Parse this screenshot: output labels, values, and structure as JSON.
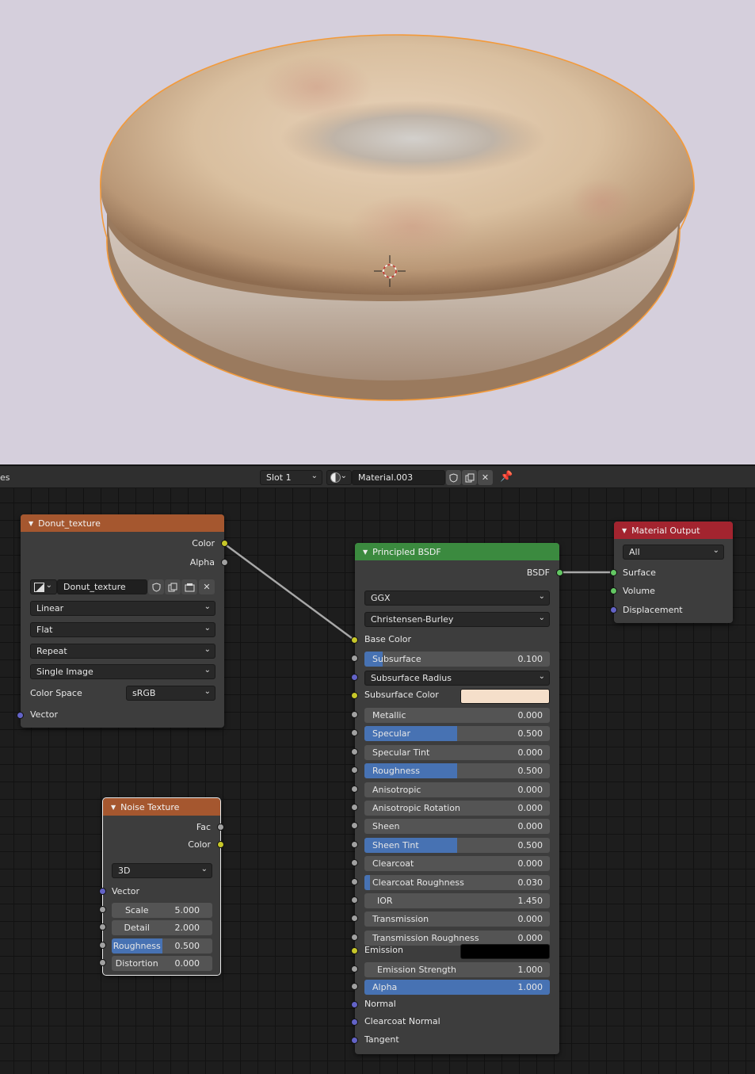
{
  "header": {
    "left_fragment": "es",
    "slot": "Slot 1",
    "material": "Material.003"
  },
  "nodes": {
    "donut_texture": {
      "title": "Donut_texture",
      "outputs": [
        "Color",
        "Alpha"
      ],
      "image_name": "Donut_texture",
      "interpolation": "Linear",
      "projection": "Flat",
      "extension": "Repeat",
      "source": "Single Image",
      "color_space_label": "Color Space",
      "color_space": "sRGB",
      "input_vector": "Vector"
    },
    "noise_texture": {
      "title": "Noise Texture",
      "outputs": [
        "Fac",
        "Color"
      ],
      "dimensions": "3D",
      "input_vector": "Vector",
      "fields": [
        {
          "name": "Scale",
          "value": "5.000",
          "fill": 0
        },
        {
          "name": "Detail",
          "value": "2.000",
          "fill": 0
        },
        {
          "name": "Roughness",
          "value": "0.500",
          "fill": 0.5
        },
        {
          "name": "Distortion",
          "value": "0.000",
          "fill": 0
        }
      ]
    },
    "principled": {
      "title": "Principled BSDF",
      "output": "BSDF",
      "distribution": "GGX",
      "subsurface_method": "Christensen-Burley",
      "base_color": "Base Color",
      "subsurface": {
        "name": "Subsurface",
        "value": "0.100",
        "fill": 0.1
      },
      "subsurface_radius": "Subsurface Radius",
      "subsurface_color": {
        "name": "Subsurface Color",
        "color": "#f5dfca"
      },
      "fields": [
        {
          "name": "Metallic",
          "value": "0.000",
          "fill": 0
        },
        {
          "name": "Specular",
          "value": "0.500",
          "fill": 0.5
        },
        {
          "name": "Specular Tint",
          "value": "0.000",
          "fill": 0
        },
        {
          "name": "Roughness",
          "value": "0.500",
          "fill": 0.5
        },
        {
          "name": "Anisotropic",
          "value": "0.000",
          "fill": 0
        },
        {
          "name": "Anisotropic Rotation",
          "value": "0.000",
          "fill": 0
        },
        {
          "name": "Sheen",
          "value": "0.000",
          "fill": 0
        },
        {
          "name": "Sheen Tint",
          "value": "0.500",
          "fill": 0.5
        },
        {
          "name": "Clearcoat",
          "value": "0.000",
          "fill": 0
        },
        {
          "name": "Clearcoat Roughness",
          "value": "0.030",
          "fill": 0.03
        },
        {
          "name": "IOR",
          "value": "1.450",
          "fill": 0
        },
        {
          "name": "Transmission",
          "value": "0.000",
          "fill": 0
        },
        {
          "name": "Transmission Roughness",
          "value": "0.000",
          "fill": 0
        }
      ],
      "emission": {
        "name": "Emission",
        "color": "#000000"
      },
      "emission_strength": {
        "name": "Emission Strength",
        "value": "1.000",
        "fill": 0
      },
      "alpha": {
        "name": "Alpha",
        "value": "1.000",
        "fill": 1
      },
      "vector_inputs": [
        "Normal",
        "Clearcoat Normal",
        "Tangent"
      ]
    },
    "material_output": {
      "title": "Material Output",
      "target": "All",
      "inputs": [
        "Surface",
        "Volume",
        "Displacement"
      ]
    }
  },
  "colors": {
    "texture_header": "#a5572f",
    "shader_header": "#3b8a3f",
    "output_header": "#a3242f",
    "slider_fill": "#4772b3",
    "viewport_bg": "#d5cfdc",
    "selection_outline": "#f39a3a"
  }
}
